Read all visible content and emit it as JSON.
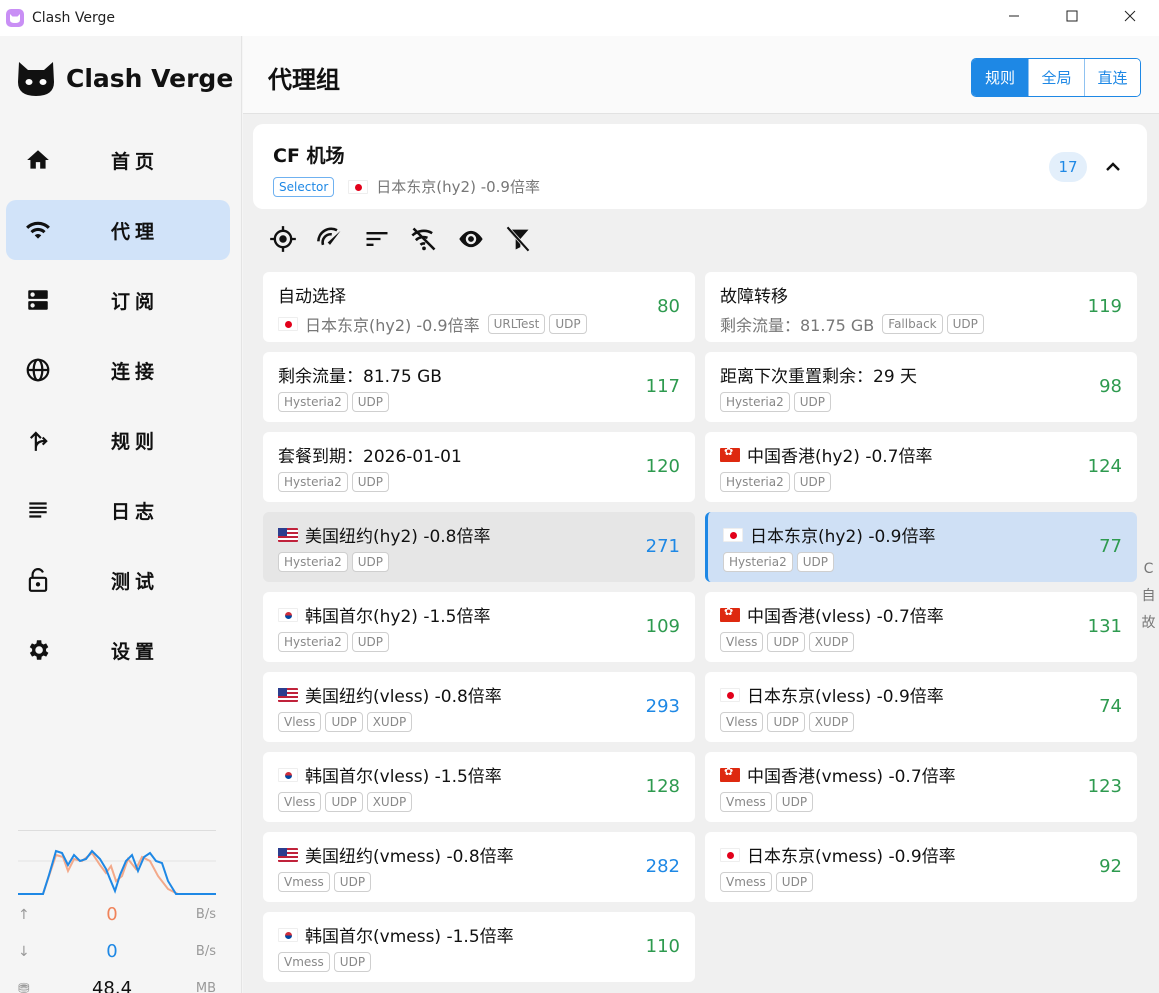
{
  "window": {
    "title": "Clash Verge"
  },
  "sidebar": {
    "brand": "Clash Verge",
    "items": [
      {
        "label": "首页",
        "icon": "home-icon",
        "active": false
      },
      {
        "label": "代理",
        "icon": "wifi-icon",
        "active": true
      },
      {
        "label": "订阅",
        "icon": "dns-icon",
        "active": false
      },
      {
        "label": "连接",
        "icon": "globe-icon",
        "active": false
      },
      {
        "label": "规则",
        "icon": "route-icon",
        "active": false
      },
      {
        "label": "日志",
        "icon": "lines-icon",
        "active": false
      },
      {
        "label": "测试",
        "icon": "lock-open-icon",
        "active": false
      },
      {
        "label": "设置",
        "icon": "gear-icon",
        "active": false
      }
    ],
    "traffic": {
      "up_value": "0",
      "up_unit": "B/s",
      "down_value": "0",
      "down_unit": "B/s",
      "mem_value": "48.4",
      "mem_unit": "MB"
    }
  },
  "header": {
    "title": "代理组",
    "modes": [
      {
        "label": "规则",
        "active": true
      },
      {
        "label": "全局",
        "active": false
      },
      {
        "label": "直连",
        "active": false
      }
    ]
  },
  "group": {
    "name": "CF 机场",
    "type_tag": "Selector",
    "current": "日本东京(hy2) -0.9倍率",
    "count": "17"
  },
  "toolbar_icons": [
    "locate-icon",
    "speed-test-icon",
    "sort-icon",
    "filter-off-icon",
    "eye-icon",
    "filter-clear-icon"
  ],
  "proxies": [
    {
      "name": "自动选择",
      "sub": "日本东京(hy2) -0.9倍率",
      "sub_flag": "jp",
      "tags": [
        "URLTest",
        "UDP"
      ],
      "delay": "80",
      "delay_color": "green",
      "state": ""
    },
    {
      "name": "故障转移",
      "sub": "剩余流量：81.75 GB",
      "sub_flag": "",
      "tags": [
        "Fallback",
        "UDP"
      ],
      "delay": "119",
      "delay_color": "green",
      "state": ""
    },
    {
      "name": "剩余流量：81.75 GB",
      "flag": "",
      "tags": [
        "Hysteria2",
        "UDP"
      ],
      "delay": "117",
      "delay_color": "green",
      "state": ""
    },
    {
      "name": "距离下次重置剩余：29 天",
      "flag": "",
      "tags": [
        "Hysteria2",
        "UDP"
      ],
      "delay": "98",
      "delay_color": "green",
      "state": ""
    },
    {
      "name": "套餐到期：2026-01-01",
      "flag": "",
      "tags": [
        "Hysteria2",
        "UDP"
      ],
      "delay": "120",
      "delay_color": "green",
      "state": ""
    },
    {
      "name": "中国香港(hy2) -0.7倍率",
      "flag": "hk",
      "tags": [
        "Hysteria2",
        "UDP"
      ],
      "delay": "124",
      "delay_color": "green",
      "state": ""
    },
    {
      "name": "美国纽约(hy2) -0.8倍率",
      "flag": "us",
      "tags": [
        "Hysteria2",
        "UDP"
      ],
      "delay": "271",
      "delay_color": "blue",
      "state": "hover"
    },
    {
      "name": "日本东京(hy2) -0.9倍率",
      "flag": "jp",
      "tags": [
        "Hysteria2",
        "UDP"
      ],
      "delay": "77",
      "delay_color": "green",
      "state": "sel"
    },
    {
      "name": "韩国首尔(hy2) -1.5倍率",
      "flag": "kr",
      "tags": [
        "Hysteria2",
        "UDP"
      ],
      "delay": "109",
      "delay_color": "green",
      "state": ""
    },
    {
      "name": "中国香港(vless) -0.7倍率",
      "flag": "hk",
      "tags": [
        "Vless",
        "UDP",
        "XUDP"
      ],
      "delay": "131",
      "delay_color": "green",
      "state": ""
    },
    {
      "name": "美国纽约(vless) -0.8倍率",
      "flag": "us",
      "tags": [
        "Vless",
        "UDP",
        "XUDP"
      ],
      "delay": "293",
      "delay_color": "blue",
      "state": ""
    },
    {
      "name": "日本东京(vless) -0.9倍率",
      "flag": "jp",
      "tags": [
        "Vless",
        "UDP",
        "XUDP"
      ],
      "delay": "74",
      "delay_color": "green",
      "state": ""
    },
    {
      "name": "韩国首尔(vless) -1.5倍率",
      "flag": "kr",
      "tags": [
        "Vless",
        "UDP",
        "XUDP"
      ],
      "delay": "128",
      "delay_color": "green",
      "state": ""
    },
    {
      "name": "中国香港(vmess) -0.7倍率",
      "flag": "hk",
      "tags": [
        "Vmess",
        "UDP"
      ],
      "delay": "123",
      "delay_color": "green",
      "state": ""
    },
    {
      "name": "美国纽约(vmess) -0.8倍率",
      "flag": "us",
      "tags": [
        "Vmess",
        "UDP"
      ],
      "delay": "282",
      "delay_color": "blue",
      "state": ""
    },
    {
      "name": "日本东京(vmess) -0.9倍率",
      "flag": "jp",
      "tags": [
        "Vmess",
        "UDP"
      ],
      "delay": "92",
      "delay_color": "green",
      "state": ""
    },
    {
      "name": "韩国首尔(vmess) -1.5倍率",
      "flag": "kr",
      "tags": [
        "Vmess",
        "UDP"
      ],
      "delay": "110",
      "delay_color": "green",
      "state": ""
    }
  ],
  "clipped_side_text": [
    "C",
    "自",
    "故"
  ]
}
